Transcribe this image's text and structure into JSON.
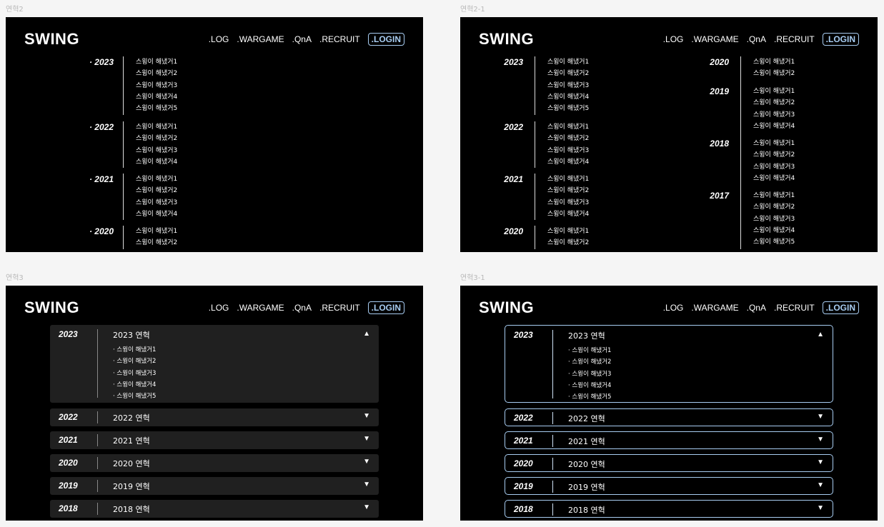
{
  "labels": {
    "f1": "연혁2",
    "f2": "연혁2-1",
    "f3": "연혁3",
    "f4": "연혁3-1"
  },
  "header": {
    "logo": "SWING",
    "nav": [
      ".LOG",
      ".WARGAME",
      ".QnA",
      ".RECRUIT"
    ],
    "login": ".LOGIN"
  },
  "timeline2": [
    {
      "year": "· 2023",
      "items": [
        "스윙이 해냈거1",
        "스윙이 해냈거2",
        "스윙이 해냈거3",
        "스윙이 해냈거4",
        "스윙이 해냈거5"
      ]
    },
    {
      "year": "· 2022",
      "items": [
        "스윙이 해냈거1",
        "스윙이 해냈거2",
        "스윙이 해냈거3",
        "스윙이 해냈거4"
      ]
    },
    {
      "year": "· 2021",
      "items": [
        "스윙이 해냈거1",
        "스윙이 해냈거2",
        "스윙이 해냈거3",
        "스윙이 해냈거4"
      ]
    },
    {
      "year": "· 2020",
      "items": [
        "스윙이 해냈거1",
        "스윙이 해냈거2"
      ]
    }
  ],
  "timeline21_left": [
    {
      "year": "2023",
      "items": [
        "스윙이 해냈거1",
        "스윙이 해냈거2",
        "스윙이 해냈거3",
        "스윙이 해냈거4",
        "스윙이 해냈거5"
      ]
    },
    {
      "year": "2022",
      "items": [
        "스윙이 해냈거1",
        "스윙이 해냈거2",
        "스윙이 해냈거3",
        "스윙이 해냈거4"
      ]
    },
    {
      "year": "2021",
      "items": [
        "스윙이 해냈거1",
        "스윙이 해냈거2",
        "스윙이 해냈거3",
        "스윙이 해냈거4"
      ]
    },
    {
      "year": "2020",
      "items": [
        "스윙이 해냈거1",
        "스윙이 해냈거2"
      ]
    }
  ],
  "timeline21_right": [
    {
      "year": "2020",
      "items": [
        "스윙이 해냈거1",
        "스윙이 해냈거2"
      ]
    },
    {
      "year": "2019",
      "items": [
        "스윙이 해냈거1",
        "스윙이 해냈거2",
        "스윙이 해냈거3",
        "스윙이 해냈거4"
      ]
    },
    {
      "year": "2018",
      "items": [
        "스윙이 해냈거1",
        "스윙이 해냈거2",
        "스윙이 해냈거3",
        "스윙이 해냈거4"
      ]
    },
    {
      "year": "2017",
      "items": [
        "스윙이 해냈거1",
        "스윙이 해냈거2",
        "스윙이 해냈거3",
        "스윙이 해냈거4",
        "스윙이 해냈거5"
      ]
    }
  ],
  "accordion": {
    "open": {
      "year": "2023",
      "title": "2023 연혁",
      "arrow": "▲",
      "items": [
        "· 스윙이 해냈거1",
        "· 스윙이 해냈거2",
        "· 스윙이 해냈거3",
        "· 스윙이 해냈거4",
        "· 스윙이 해냈거5"
      ]
    },
    "closed": [
      {
        "year": "2022",
        "title": "2022 연혁",
        "arrow": "▼"
      },
      {
        "year": "2021",
        "title": "2021 연혁",
        "arrow": "▼"
      },
      {
        "year": "2020",
        "title": "2020 연혁",
        "arrow": "▼"
      },
      {
        "year": "2019",
        "title": "2019 연혁",
        "arrow": "▼"
      },
      {
        "year": "2018",
        "title": "2018 연혁",
        "arrow": "▼"
      }
    ]
  },
  "colors": {
    "accent": "#a8cdf2",
    "panel": "#202020",
    "background": "#000000",
    "canvas": "#f5f5f5"
  }
}
